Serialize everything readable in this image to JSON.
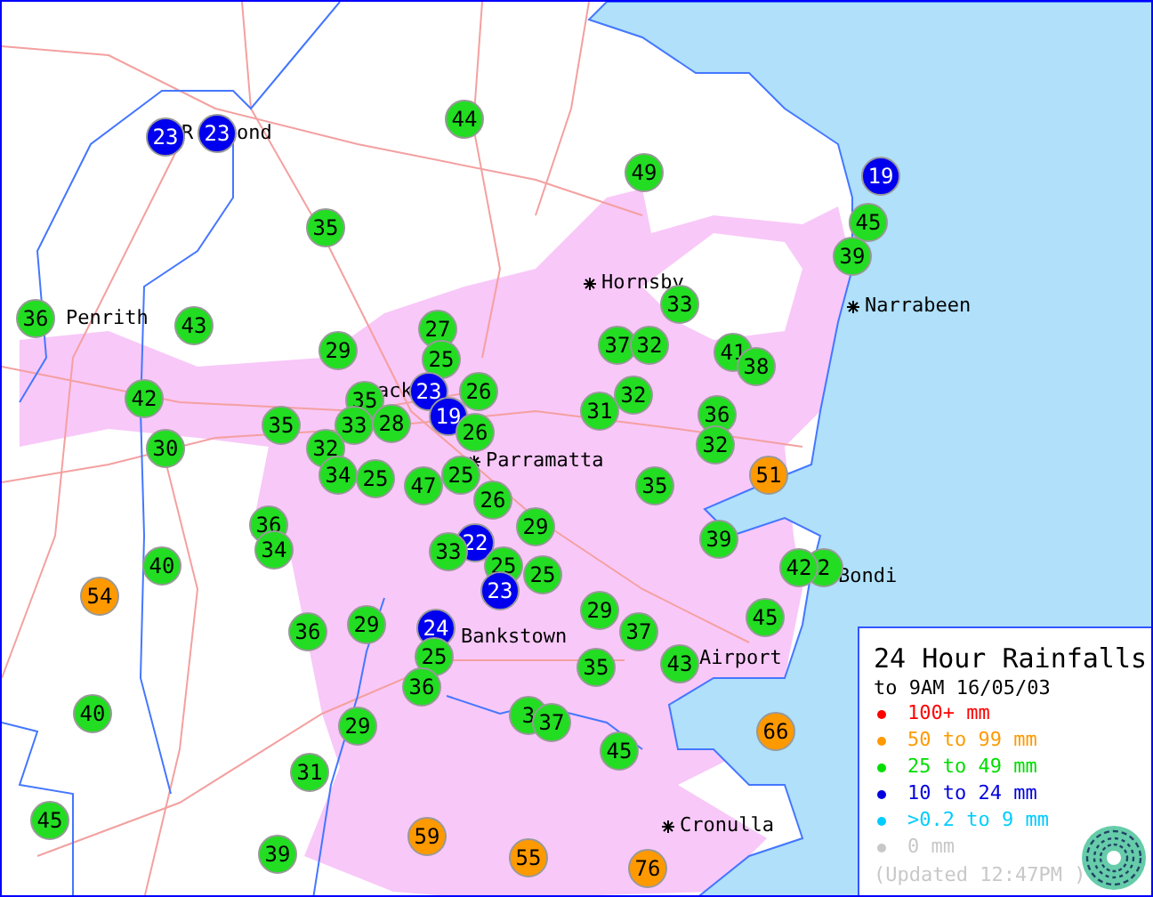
{
  "map": {
    "places": [
      {
        "name": "Penrith",
        "marker": false
      },
      {
        "name": "R",
        "marker": false
      },
      {
        "name": "ond",
        "marker": false
      },
      {
        "name": "ack",
        "marker": false
      },
      {
        "name": "Parramatta",
        "marker": true
      },
      {
        "name": "Hornsby",
        "marker": true
      },
      {
        "name": "Narrabeen",
        "marker": true
      },
      {
        "name": "Bondi",
        "marker": false
      },
      {
        "name": "Airport",
        "marker": false
      },
      {
        "name": "Bankstown",
        "marker": false
      },
      {
        "name": "Cronulla",
        "marker": true
      }
    ],
    "stations": [
      {
        "value": "23",
        "color": "#0000ee"
      },
      {
        "value": "23",
        "color": "#0000ee"
      },
      {
        "value": "44",
        "color": "#22dd22"
      },
      {
        "value": "35",
        "color": "#22dd22"
      },
      {
        "value": "36",
        "color": "#22dd22"
      },
      {
        "value": "43",
        "color": "#22dd22"
      },
      {
        "value": "29",
        "color": "#22dd22"
      },
      {
        "value": "27",
        "color": "#22dd22"
      },
      {
        "value": "25",
        "color": "#22dd22"
      },
      {
        "value": "42",
        "color": "#22dd22"
      },
      {
        "value": "35",
        "color": "#22dd22"
      },
      {
        "value": "33",
        "color": "#22dd22"
      },
      {
        "value": "28",
        "color": "#22dd22"
      },
      {
        "value": "23",
        "color": "#0000ee"
      },
      {
        "value": "19",
        "color": "#0000ee"
      },
      {
        "value": "26",
        "color": "#22dd22"
      },
      {
        "value": "26",
        "color": "#22dd22"
      },
      {
        "value": "35",
        "color": "#22dd22"
      },
      {
        "value": "32",
        "color": "#22dd22"
      },
      {
        "value": "49",
        "color": "#22dd22"
      },
      {
        "value": "19",
        "color": "#0000ee"
      },
      {
        "value": "45",
        "color": "#22dd22"
      },
      {
        "value": "39",
        "color": "#22dd22"
      },
      {
        "value": "33",
        "color": "#22dd22"
      },
      {
        "value": "37",
        "color": "#22dd22"
      },
      {
        "value": "32",
        "color": "#22dd22"
      },
      {
        "value": "41",
        "color": "#22dd22"
      },
      {
        "value": "38",
        "color": "#22dd22"
      },
      {
        "value": "32",
        "color": "#22dd22"
      },
      {
        "value": "31",
        "color": "#22dd22"
      },
      {
        "value": "36",
        "color": "#22dd22"
      },
      {
        "value": "30",
        "color": "#22dd22"
      },
      {
        "value": "32",
        "color": "#22dd22"
      },
      {
        "value": "34",
        "color": "#22dd22"
      },
      {
        "value": "25",
        "color": "#22dd22"
      },
      {
        "value": "47",
        "color": "#22dd22"
      },
      {
        "value": "25",
        "color": "#22dd22"
      },
      {
        "value": "26",
        "color": "#22dd22"
      },
      {
        "value": "36",
        "color": "#22dd22"
      },
      {
        "value": "34",
        "color": "#22dd22"
      },
      {
        "value": "40",
        "color": "#22dd22"
      },
      {
        "value": "29",
        "color": "#22dd22"
      },
      {
        "value": "22",
        "color": "#0000ee"
      },
      {
        "value": "33",
        "color": "#22dd22"
      },
      {
        "value": "25",
        "color": "#22dd22"
      },
      {
        "value": "23",
        "color": "#0000ee"
      },
      {
        "value": "25",
        "color": "#22dd22"
      },
      {
        "value": "54",
        "color": "#ff9900"
      },
      {
        "value": "36",
        "color": "#22dd22"
      },
      {
        "value": "29",
        "color": "#22dd22"
      },
      {
        "value": "24",
        "color": "#0000ee"
      },
      {
        "value": "25",
        "color": "#22dd22"
      },
      {
        "value": "36",
        "color": "#22dd22"
      },
      {
        "value": "40",
        "color": "#22dd22"
      },
      {
        "value": "29",
        "color": "#22dd22"
      },
      {
        "value": "3",
        "color": "#22dd22"
      },
      {
        "value": "37",
        "color": "#22dd22"
      },
      {
        "value": "31",
        "color": "#22dd22"
      },
      {
        "value": "45",
        "color": "#22dd22"
      },
      {
        "value": "39",
        "color": "#22dd22"
      },
      {
        "value": "59",
        "color": "#ff9900"
      },
      {
        "value": "55",
        "color": "#ff9900"
      },
      {
        "value": "51",
        "color": "#ff9900"
      },
      {
        "value": "35",
        "color": "#22dd22"
      },
      {
        "value": "39",
        "color": "#22dd22"
      },
      {
        "value": "42",
        "color": "#22dd22"
      },
      {
        "value": "2",
        "color": "#22dd22"
      },
      {
        "value": "29",
        "color": "#22dd22"
      },
      {
        "value": "37",
        "color": "#22dd22"
      },
      {
        "value": "45",
        "color": "#22dd22"
      },
      {
        "value": "35",
        "color": "#22dd22"
      },
      {
        "value": "43",
        "color": "#22dd22"
      },
      {
        "value": "45",
        "color": "#22dd22"
      },
      {
        "value": "66",
        "color": "#ff9900"
      },
      {
        "value": "76",
        "color": "#ff9900"
      }
    ]
  },
  "legend": {
    "title": "24 Hour Rainfalls",
    "subtitle": "to 9AM 16/05/03",
    "items": [
      {
        "label": "100+ mm",
        "color": "#ff0000"
      },
      {
        "label": "50 to 99 mm",
        "color": "#ff9900"
      },
      {
        "label": "25 to 49 mm",
        "color": "#00dd00"
      },
      {
        "label": "10 to 24 mm",
        "color": "#0000dd"
      },
      {
        "label": ">0.2 to 9 mm",
        "color": "#00ccff"
      },
      {
        "label": "0 mm",
        "color": "#c8c8c8"
      }
    ],
    "updated": "(Updated 12:47PM  )"
  }
}
